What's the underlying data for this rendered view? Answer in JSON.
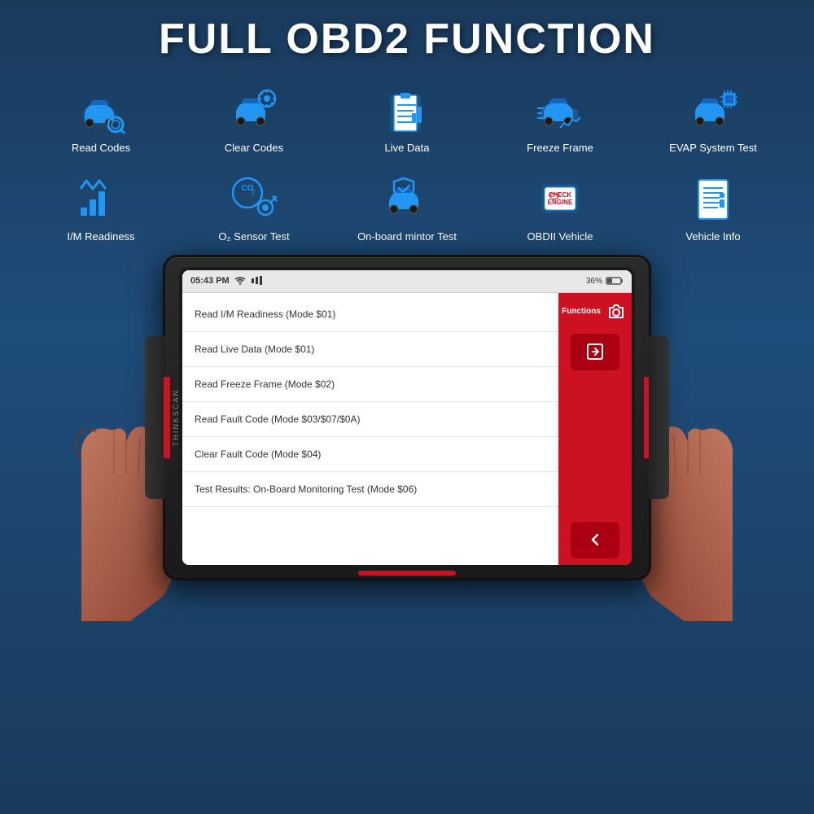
{
  "header": {
    "title": "FULL OBD2 FUNCTION"
  },
  "functions": [
    {
      "id": "read-codes",
      "label": "Read Codes",
      "icon": "car-search"
    },
    {
      "id": "clear-codes",
      "label": "Clear Codes",
      "icon": "car-settings"
    },
    {
      "id": "live-data",
      "label": "Live Data",
      "icon": "clipboard-chart"
    },
    {
      "id": "freeze-frame",
      "label": "Freeze Frame",
      "icon": "car-graph"
    },
    {
      "id": "evap-system",
      "label": "EVAP System Test",
      "icon": "car-chip"
    },
    {
      "id": "im-readiness",
      "label": "I/M Readiness",
      "icon": "bars-chart"
    },
    {
      "id": "o2-sensor",
      "label": "O₂ Sensor Test",
      "icon": "co2-sensor"
    },
    {
      "id": "onboard-monitor",
      "label": "On-board mintor Test",
      "icon": "car-shield"
    },
    {
      "id": "obdii-vehicle",
      "label": "OBDII Vehicle",
      "icon": "check-engine"
    },
    {
      "id": "vehicle-info",
      "label": "Vehicle Info",
      "icon": "document-list"
    }
  ],
  "device": {
    "brand": "THINKSCAN",
    "status_bar": {
      "time": "05:43 PM",
      "battery": "36%"
    },
    "menu_items": [
      "Read I/M Readiness (Mode $01)",
      "Read Live Data (Mode $01)",
      "Read Freeze Frame (Mode $02)",
      "Read Fault Code (Mode $03/$07/$0A)",
      "Clear Fault Code (Mode $04)",
      "Test Results: On-Board Monitoring Test (Mode $06)"
    ],
    "right_panel": {
      "label": "Functions"
    }
  }
}
